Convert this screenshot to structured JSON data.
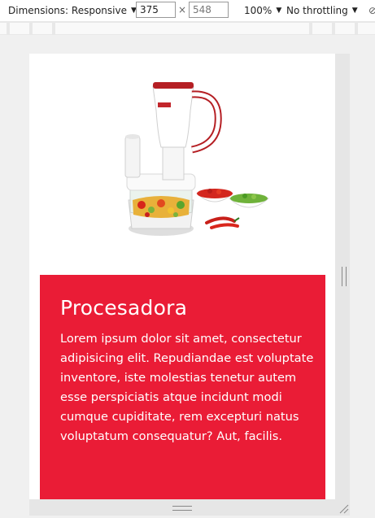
{
  "toolbar": {
    "dimensions_label": "Dimensions: Responsive",
    "width_value": "375",
    "height_value": "548",
    "times_symbol": "×",
    "zoom_label": "100%",
    "throttle_label": "No throttling",
    "more_symbol": "⊘"
  },
  "card": {
    "title": "Procesadora",
    "body": "Lorem ipsum dolor sit amet, consectetur adipisicing elit. Repudiandae est voluptate inventore, iste molestias tenetur autem esse perspiciatis atque incidunt modi cumque cupiditate, rem excepturi natus voluptatum consequatur? Aut, facilis.",
    "background_color": "#ea1c36"
  },
  "product_image": {
    "icon": "food-processor-illustration"
  }
}
